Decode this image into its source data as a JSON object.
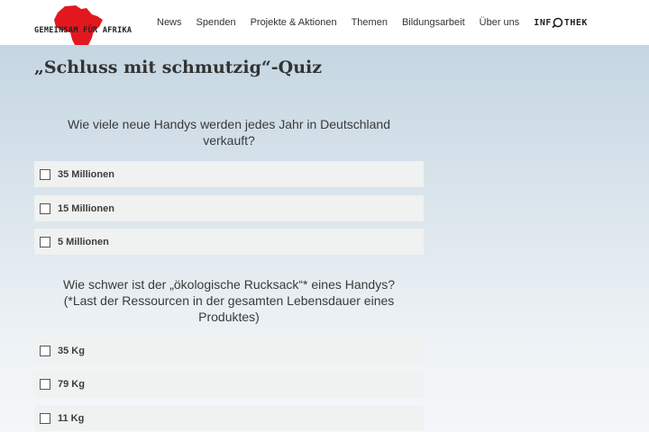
{
  "header": {
    "logo": {
      "text": "GEMEINSAM FÜR AFRIKA",
      "map_color": "#e3181f"
    },
    "nav": [
      {
        "label": "News"
      },
      {
        "label": "Spenden"
      },
      {
        "label": "Projekte & Aktionen"
      },
      {
        "label": "Themen"
      },
      {
        "label": "Bildungsarbeit"
      },
      {
        "label": "Über uns"
      }
    ],
    "infothek": {
      "before": "INF",
      "icon": "magnifier-icon",
      "after": "THEK"
    }
  },
  "main": {
    "title": "„Schluss mit schmutzig“-Quiz",
    "questions": [
      {
        "lines": [
          "Wie viele neue Handys werden jedes Jahr in Deutschland",
          "verkauft?"
        ],
        "answers": [
          {
            "label": "35 Millionen",
            "checked": false
          },
          {
            "label": "15 Millionen",
            "checked": false
          },
          {
            "label": "5 Millionen",
            "checked": false
          }
        ]
      },
      {
        "lines": [
          "Wie schwer ist der „ökologische Rucksack“* eines Handys?",
          "(*Last der Ressourcen in der gesamten Lebensdauer eines",
          "Produktes)"
        ],
        "answers": [
          {
            "label": "35 Kg",
            "checked": false
          },
          {
            "label": "79 Kg",
            "checked": false
          },
          {
            "label": "11 Kg",
            "checked": false
          }
        ]
      }
    ]
  }
}
